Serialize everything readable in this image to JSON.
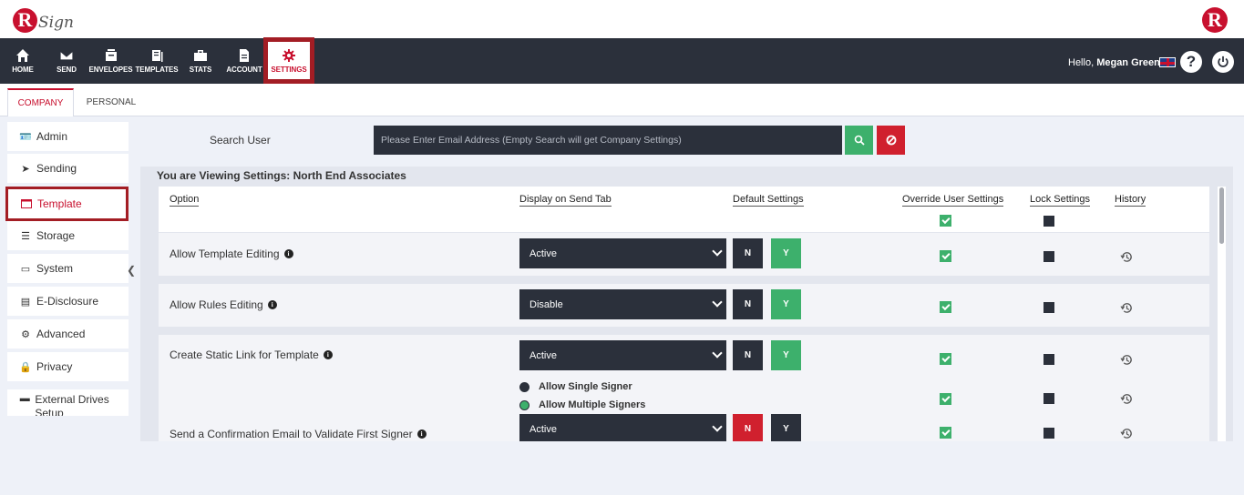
{
  "brand": {
    "logo_letter": "R",
    "logo_text": "Sign",
    "right_logo_letter": "R"
  },
  "colors": {
    "navbar": "#2b303b",
    "brand_red": "#c8102e",
    "success_green": "#3db06c",
    "danger_red": "#d0202e",
    "page_bg": "#eef1f8"
  },
  "nav": {
    "items": [
      {
        "label": "HOME",
        "icon": "home-icon"
      },
      {
        "label": "SEND",
        "icon": "envelope-icon"
      },
      {
        "label": "ENVELOPES",
        "icon": "envelopes-icon"
      },
      {
        "label": "TEMPLATES",
        "icon": "templates-icon"
      },
      {
        "label": "STATS",
        "icon": "briefcase-icon"
      },
      {
        "label": "ACCOUNT",
        "icon": "account-icon"
      },
      {
        "label": "SETTINGS",
        "icon": "gear-icon"
      }
    ],
    "active": "SETTINGS"
  },
  "user": {
    "greeting": "Hello,",
    "name": "Megan Greene",
    "help_symbol": "?"
  },
  "tabs": [
    {
      "label": "COMPANY",
      "active": true
    },
    {
      "label": "PERSONAL",
      "active": false
    }
  ],
  "sidebar": {
    "items": [
      {
        "label": "Admin",
        "icon": "admin-card-icon"
      },
      {
        "label": "Sending",
        "icon": "paper-plane-icon"
      },
      {
        "label": "Template",
        "icon": "window-icon",
        "active": true
      },
      {
        "label": "Storage",
        "icon": "database-icon"
      },
      {
        "label": "System",
        "icon": "monitor-icon"
      },
      {
        "label": "E-Disclosure",
        "icon": "document-icon"
      },
      {
        "label": "Advanced",
        "icon": "cogs-icon"
      },
      {
        "label": "Privacy",
        "icon": "lock-icon"
      },
      {
        "label": "External Drives Setup",
        "icon": "drive-icon"
      }
    ]
  },
  "search": {
    "label": "Search User",
    "placeholder": "Please Enter Email Address (Empty Search will get Company Settings)",
    "value": ""
  },
  "panel": {
    "title": "You are Viewing Settings: North End Associates",
    "columns": {
      "option": "Option",
      "display": "Display on Send Tab",
      "default": "Default Settings",
      "override": "Override User Settings",
      "lock": "Lock Settings",
      "history": "History"
    },
    "rows": [
      {
        "label": "Allow Template Editing",
        "display": "Active",
        "n_label": "N",
        "y_label": "Y",
        "default": "Y",
        "override": true,
        "lock": true
      },
      {
        "label": "Allow Rules Editing",
        "display": "Disable",
        "n_label": "N",
        "y_label": "Y",
        "default": "Y",
        "override": true,
        "lock": true
      },
      {
        "label": "Create Static Link for Template",
        "display": "Active",
        "n_label": "N",
        "y_label": "Y",
        "default": "Y",
        "override": true,
        "lock": true,
        "sub_options": [
          {
            "label": "Allow Single Signer",
            "selected": false
          },
          {
            "label": "Allow Multiple Signers",
            "selected": true
          }
        ]
      },
      {
        "label": "Send a Confirmation Email to Validate First Signer",
        "display": "Active",
        "n_label": "N",
        "y_label": "Y",
        "default": "N",
        "override": true,
        "lock": true
      }
    ]
  }
}
